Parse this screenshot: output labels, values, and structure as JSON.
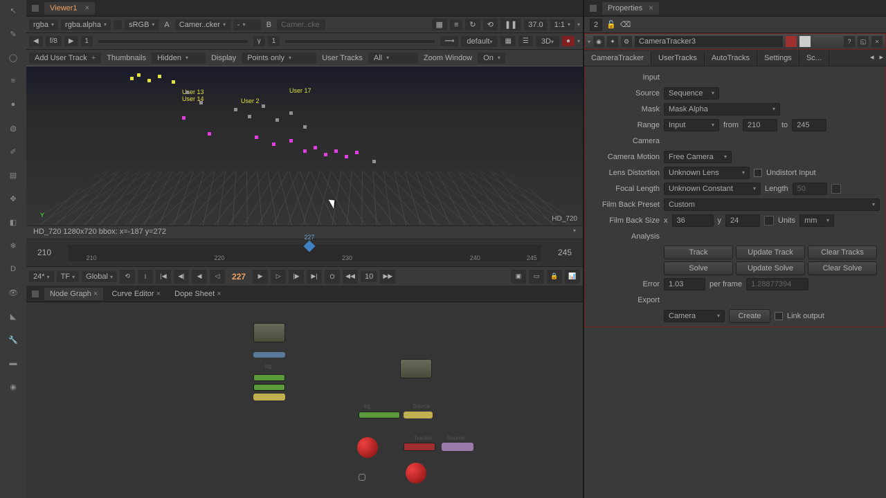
{
  "viewer": {
    "tab": "Viewer1",
    "channels": "rgba",
    "alpha": "rgba.alpha",
    "colorspace": "sRGB",
    "a_input": "Camer..cker",
    "a_label": "A",
    "b_label": "B",
    "b_input": "Camer..cke",
    "zoom_pct": "37.0",
    "zoom_ratio": "1:1",
    "fstop": "f/8",
    "fval": "1",
    "gamma_lbl": "γ",
    "gamma_val": "1",
    "lut": "default",
    "view_mode": "3D"
  },
  "tracker_bar": {
    "add": "Add User Track",
    "thumbs_lbl": "Thumbnails",
    "thumbs_val": "Hidden",
    "display_lbl": "Display",
    "display_val": "Points only",
    "user_lbl": "User Tracks",
    "user_val": "All",
    "zoom_lbl": "Zoom Window",
    "zoom_val": "On"
  },
  "viewport": {
    "hd": "HD_720",
    "info": "HD_720 1280x720  bbox:   x=-187 y=272",
    "trackers": [
      "User 2",
      "User 14",
      "User 13",
      "User 17"
    ]
  },
  "timeline": {
    "start": "210",
    "end": "245",
    "current": "227",
    "ticks": [
      {
        "v": "210",
        "p": 5
      },
      {
        "v": "220",
        "p": 32
      },
      {
        "v": "227",
        "p": 51
      },
      {
        "v": "230",
        "p": 59
      },
      {
        "v": "240",
        "p": 86
      },
      {
        "v": "245",
        "p": 98
      }
    ]
  },
  "playbar": {
    "fps": "24*",
    "tf": "TF",
    "scope": "Global",
    "inc": "10",
    "current": "227"
  },
  "panels": {
    "tabs": [
      "Node Graph",
      "Curve Editor",
      "Dope Sheet"
    ],
    "active": 0
  },
  "props": {
    "title": "Properties",
    "node": "CameraTracker3",
    "stack": "2",
    "tabs": [
      "CameraTracker",
      "UserTracks",
      "AutoTracks",
      "Settings",
      "Sc..."
    ],
    "input_section": "Input",
    "source_lbl": "Source",
    "source": "Sequence",
    "mask_lbl": "Mask",
    "mask": "Mask Alpha",
    "range_lbl": "Range",
    "range": "Input",
    "from_lbl": "from",
    "from": "210",
    "to_lbl": "to",
    "to": "245",
    "camera_section": "Camera",
    "motion_lbl": "Camera Motion",
    "motion": "Free Camera",
    "lens_lbl": "Lens Distortion",
    "lens": "Unknown Lens",
    "undistort": "Undistort Input",
    "focal_lbl": "Focal Length",
    "focal": "Unknown Constant",
    "length_lbl": "Length",
    "length": "50",
    "preset_lbl": "Film Back Preset",
    "preset": "Custom",
    "size_lbl": "Film Back Size",
    "size_x_lbl": "x",
    "size_x": "36",
    "size_y_lbl": "y",
    "size_y": "24",
    "units_lbl": "Units",
    "units": "mm",
    "analysis_section": "Analysis",
    "track": "Track",
    "update_track": "Update Track",
    "clear_tracks": "Clear Tracks",
    "solve": "Solve",
    "update_solve": "Update Solve",
    "clear_solve": "Clear Solve",
    "error_lbl": "Error",
    "error": "1.03",
    "perframe_lbl": "per frame",
    "perframe": "1.28877394",
    "export_section": "Export",
    "export_type": "Camera",
    "create": "Create",
    "link": "Link output"
  },
  "icons": {
    "chev": "▾",
    "close": "×",
    "play": "▶",
    "stepb": "◀",
    "first": "|◀",
    "last": "▶|",
    "pause": "❚❚",
    "refresh": "↻"
  }
}
